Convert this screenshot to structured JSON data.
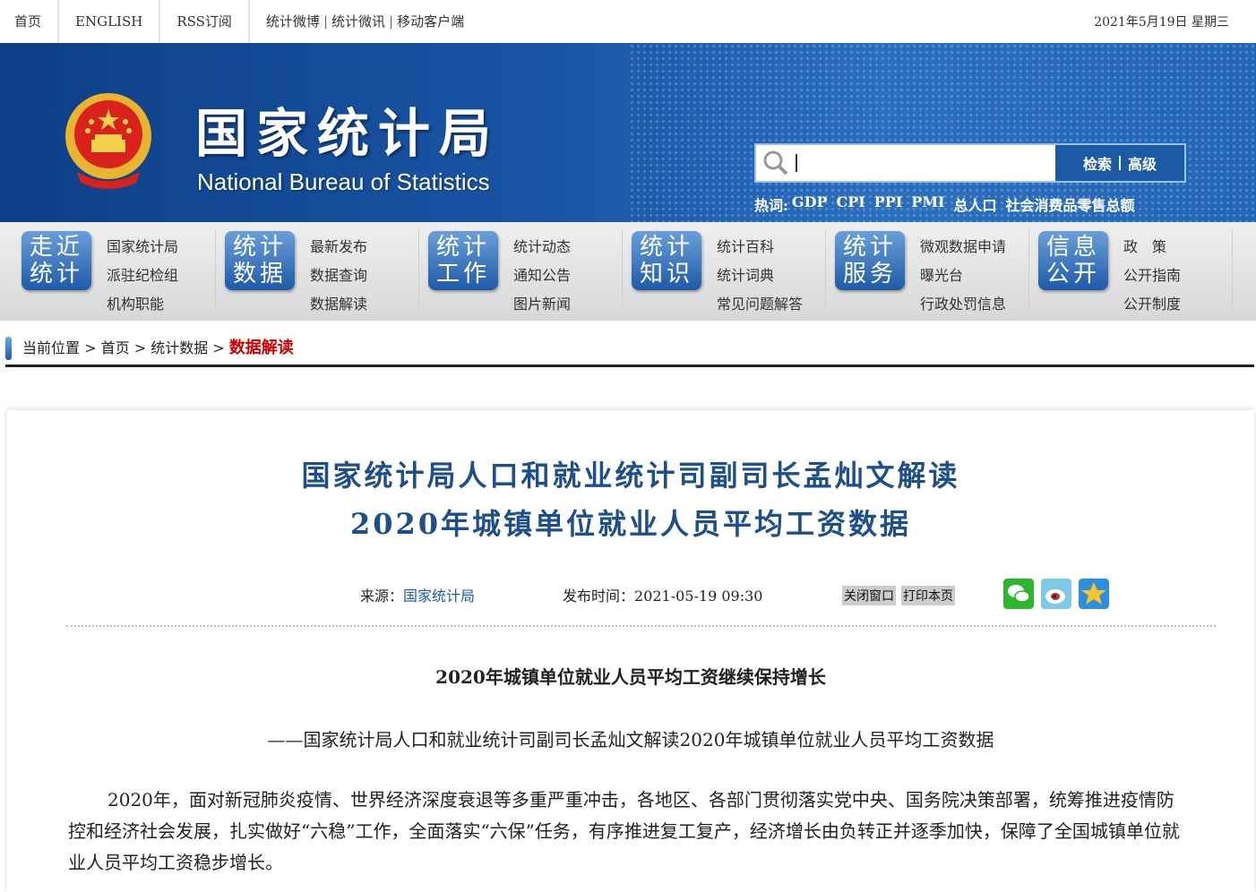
{
  "topbar": {
    "home": "首页",
    "english": "ENGLISH",
    "rss": "RSS订阅",
    "weibo": "统计微博",
    "weixun": "统计微讯",
    "mobile": "移动客户端",
    "sep": "|",
    "date": "2021年5月19日 星期三"
  },
  "banner": {
    "title_cn": "国家统计局",
    "title_en": "National Bureau of Statistics",
    "search_value": "",
    "search_btn": "检索",
    "advanced_btn": "高级",
    "hot_label": "热词:",
    "hot_words": [
      "GDP",
      "CPI",
      "PPI",
      "PMI",
      "总人口",
      "社会消费品零售总额"
    ]
  },
  "nav": [
    {
      "badge": "走近统计",
      "items": [
        "国家统计局",
        "派驻纪检组",
        "机构职能"
      ]
    },
    {
      "badge": "统计数据",
      "items": [
        "最新发布",
        "数据查询",
        "数据解读"
      ]
    },
    {
      "badge": "统计工作",
      "items": [
        "统计动态",
        "通知公告",
        "图片新闻"
      ]
    },
    {
      "badge": "统计知识",
      "items": [
        "统计百科",
        "统计词典",
        "常见问题解答"
      ]
    },
    {
      "badge": "统计服务",
      "items": [
        "微观数据申请",
        "曝光台",
        "行政处罚信息"
      ]
    },
    {
      "badge": "信息公开",
      "items": [
        "政　策",
        "公开指南",
        "公开制度"
      ]
    }
  ],
  "breadcrumb": {
    "label": "当前位置",
    "sep": " > ",
    "home": "首页",
    "section": "统计数据",
    "current": "数据解读"
  },
  "article": {
    "title_line1": "国家统计局人口和就业统计司副司长孟灿文解读",
    "title_line2": "2020年城镇单位就业人员平均工资数据",
    "source_label": "来源：",
    "source": "国家统计局",
    "time_label": "发布时间：",
    "time": "2021-05-19 09:30",
    "close_btn": "关闭窗口",
    "print_btn": "打印本页",
    "heading": "2020年城镇单位就业人员平均工资继续保持增长",
    "subheading": "——国家统计局人口和就业统计司副司长孟灿文解读2020年城镇单位就业人员平均工资数据",
    "paragraph": "2020年，面对新冠肺炎疫情、世界经济深度衰退等多重严重冲击，各地区、各部门贯彻落实党中央、国务院决策部署，统筹推进疫情防控和经济社会发展，扎实做好“六稳”工作，全面落实“六保”任务，有序推进复工复产，经济增长由负转正并逐季加快，保障了全国城镇单位就业人员平均工资稳步增长。"
  },
  "colors": {
    "brand_blue": "#1d5aa6",
    "title_blue": "#1d4f8a",
    "current_red": "#cc0000"
  }
}
